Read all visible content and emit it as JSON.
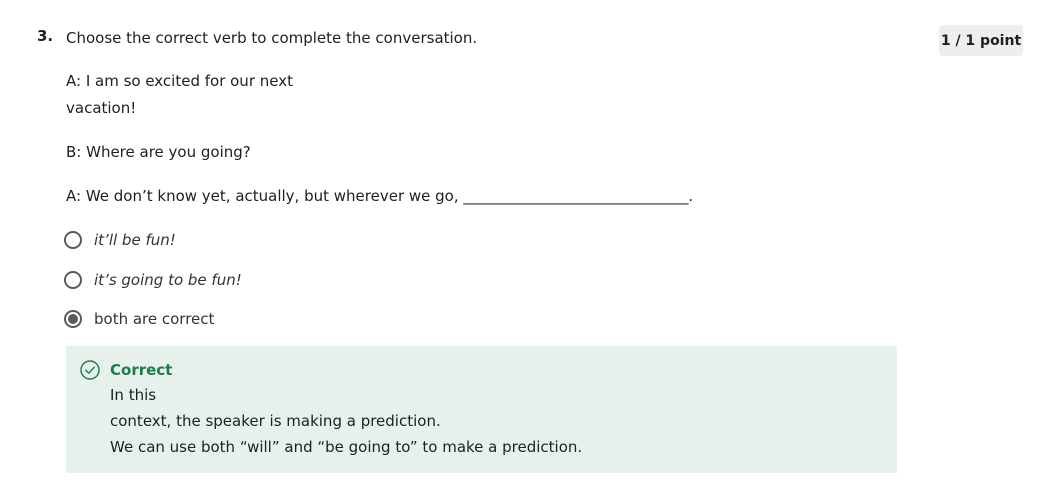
{
  "question": {
    "number": "3.",
    "prompt": "Choose the correct verb to complete the conversation.",
    "points": "1 / 1 point"
  },
  "conversation": {
    "line1a": "A: I am so excited for our next",
    "line1b": "vacation!",
    "line2": "B: Where are you going?",
    "line3": "A: We don’t know yet, actually, but wherever we go, ______________________________."
  },
  "options": [
    {
      "label": "it’ll be fun!",
      "selected": false
    },
    {
      "label": "it’s going to be fun!",
      "selected": false
    },
    {
      "label": "both are correct",
      "selected": true
    }
  ],
  "feedback": {
    "status": "Correct",
    "line1": "In this",
    "line2": "context, the speaker is making a prediction.",
    "line3": "We can use both “will” and “be going to” to make a prediction.",
    "color": "#1e7b4b",
    "background": "#e6f1ec",
    "icon": "check-circle-icon"
  }
}
